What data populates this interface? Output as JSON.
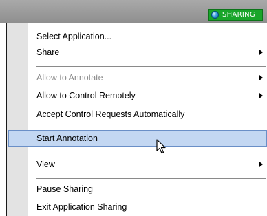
{
  "topbar": {
    "badge_label": "SHARING",
    "badge_icon": "globe-icon",
    "badge_color": "#19a52a"
  },
  "menu": {
    "items": [
      {
        "label": "Select Application...",
        "enabled": true,
        "submenu": false
      },
      {
        "label": "Share",
        "enabled": true,
        "submenu": true
      },
      {
        "label": "Allow to Annotate",
        "enabled": false,
        "submenu": true
      },
      {
        "label": "Allow to Control Remotely",
        "enabled": true,
        "submenu": true
      },
      {
        "label": "Accept Control Requests Automatically",
        "enabled": true,
        "submenu": false
      },
      {
        "label": "Start Annotation",
        "enabled": true,
        "submenu": false,
        "highlighted": true
      },
      {
        "label": "View",
        "enabled": true,
        "submenu": true
      },
      {
        "label": "Pause Sharing",
        "enabled": true,
        "submenu": false
      },
      {
        "label": "Exit Application Sharing",
        "enabled": true,
        "submenu": false
      }
    ],
    "highlight_color": "#c3d7f2"
  }
}
